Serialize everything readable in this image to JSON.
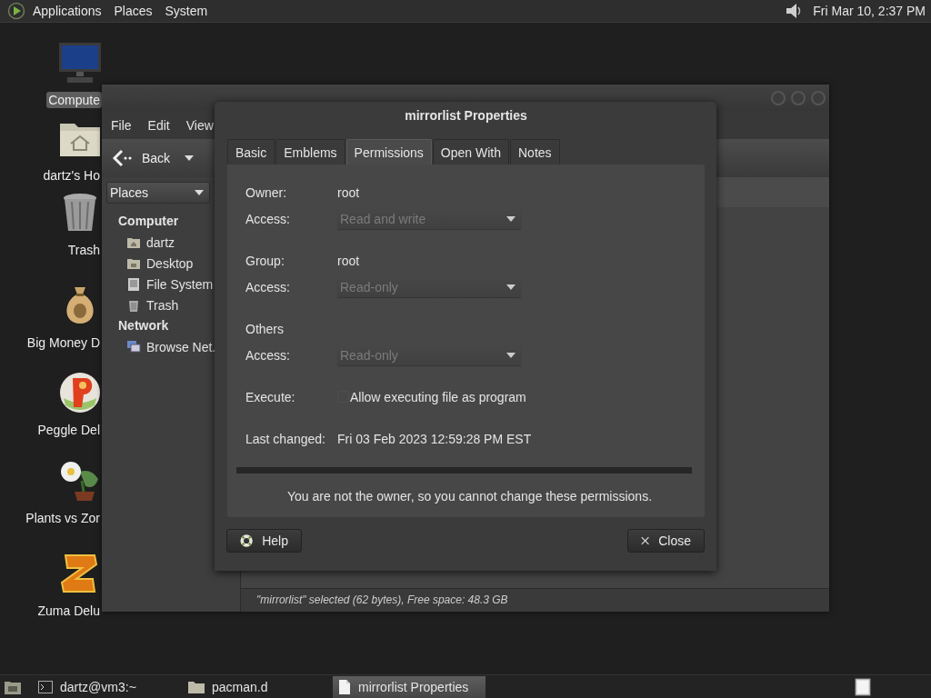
{
  "top_panel": {
    "menus": [
      "Applications",
      "Places",
      "System"
    ],
    "clock": "Fri Mar 10, 2:37 PM"
  },
  "desktop_icons": [
    {
      "label": "Compute",
      "kind": "computer",
      "selected": true
    },
    {
      "label": "dartz's Ho",
      "kind": "home",
      "selected": false
    },
    {
      "label": "Trash",
      "kind": "trash",
      "selected": false
    },
    {
      "label": "Big Money D",
      "kind": "moneybag",
      "selected": false
    },
    {
      "label": "Peggle Del",
      "kind": "ball",
      "selected": false
    },
    {
      "label": "Plants vs Zor",
      "kind": "flower",
      "selected": false
    },
    {
      "label": "Zuma Delu",
      "kind": "block",
      "selected": false
    }
  ],
  "file_manager": {
    "menus": [
      "File",
      "Edit",
      "View"
    ],
    "back_button": "Back",
    "places_dropdown": "Places",
    "sidebar": [
      {
        "heading": "Computer",
        "items": [
          {
            "label": "dartz",
            "kind": "home"
          },
          {
            "label": "Desktop",
            "kind": "desktop"
          },
          {
            "label": "File System",
            "kind": "drive"
          },
          {
            "label": "Trash",
            "kind": "trash"
          }
        ]
      },
      {
        "heading": "Network",
        "items": [
          {
            "label": "Browse Net.",
            "kind": "network"
          }
        ]
      }
    ],
    "status_bar": "\"mirrorlist\" selected (62 bytes), Free space: 48.3 GB"
  },
  "dialog": {
    "title": "mirrorlist Properties",
    "tabs": [
      {
        "label": "Basic",
        "selected": false
      },
      {
        "label": "Emblems",
        "selected": false
      },
      {
        "label": "Permissions",
        "selected": true
      },
      {
        "label": "Open With",
        "selected": false
      },
      {
        "label": "Notes",
        "selected": false
      }
    ],
    "sections": [
      {
        "rows": [
          {
            "kind": "text",
            "label": "Owner:",
            "value": "root"
          },
          {
            "kind": "dropdown",
            "label": "Access:",
            "value": "Read and write",
            "disabled": true
          }
        ]
      },
      {
        "rows": [
          {
            "kind": "text",
            "label": "Group:",
            "value": "root"
          },
          {
            "kind": "dropdown",
            "label": "Access:",
            "value": "Read-only",
            "disabled": true
          }
        ]
      },
      {
        "rows": [
          {
            "kind": "heading",
            "label": "Others"
          },
          {
            "kind": "dropdown",
            "label": "Access:",
            "value": "Read-only",
            "disabled": true
          }
        ]
      },
      {
        "rows": [
          {
            "kind": "checkbox",
            "label": "Execute:",
            "value": "Allow executing file as program",
            "checked": false,
            "disabled": true
          }
        ]
      },
      {
        "rows": [
          {
            "kind": "text",
            "label": "Last changed:",
            "value": "Fri 03 Feb 2023 12:59:28 PM EST"
          }
        ]
      }
    ],
    "notice": "You are not the owner, so you cannot change these permissions.",
    "buttons": [
      {
        "label": "Help",
        "kind": "help"
      },
      {
        "label": "Close",
        "kind": "close"
      }
    ]
  },
  "taskbar": {
    "items": [
      {
        "label": "dartz@vm3:~",
        "kind": "terminal",
        "selected": false
      },
      {
        "label": "pacman.d",
        "kind": "folder",
        "selected": false
      },
      {
        "label": "mirrorlist Properties",
        "kind": "document",
        "selected": true
      }
    ]
  }
}
